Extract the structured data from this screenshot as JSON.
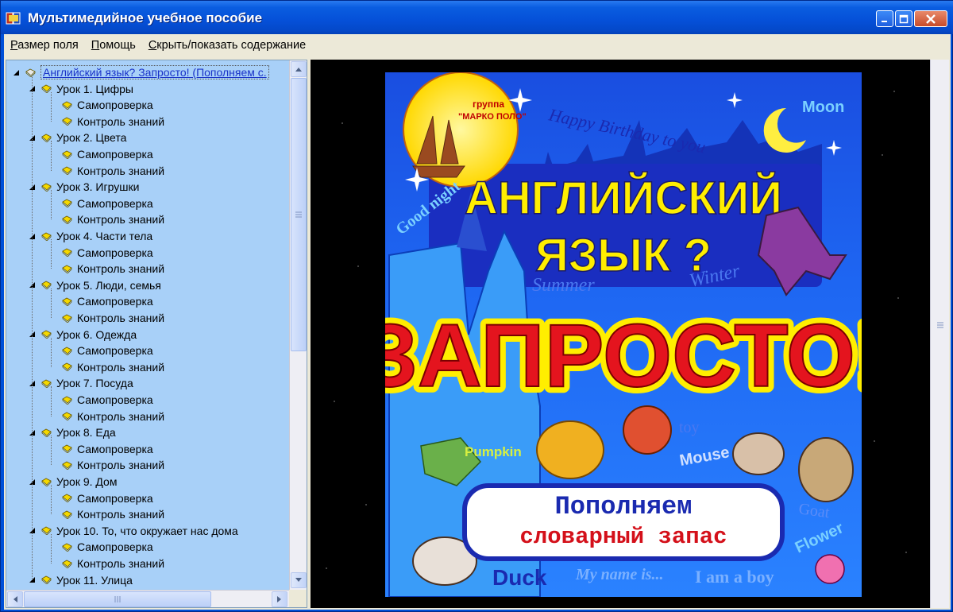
{
  "window": {
    "title": "Мультимедийное учебное пособие"
  },
  "menu": {
    "items": [
      {
        "label": "Размер поля",
        "underline_index": 0
      },
      {
        "label": "Помощь",
        "underline_index": 0
      },
      {
        "label": "Скрыть/показать содержание",
        "underline_index": 0
      }
    ]
  },
  "tree": {
    "root_label": "Английский язык? Запросто! (Пополняем с.",
    "lessons": [
      {
        "label": "Урок 1. Цифры",
        "children": [
          "Самопроверка",
          "Контроль знаний"
        ]
      },
      {
        "label": "Урок 2. Цвета",
        "children": [
          "Самопроверка",
          "Контроль знаний"
        ]
      },
      {
        "label": "Урок 3. Игрушки",
        "children": [
          "Самопроверка",
          "Контроль знаний"
        ]
      },
      {
        "label": "Урок 4. Части тела",
        "children": [
          "Самопроверка",
          "Контроль знаний"
        ]
      },
      {
        "label": "Урок 5. Люди, семья",
        "children": [
          "Самопроверка",
          "Контроль знаний"
        ]
      },
      {
        "label": "Урок 6. Одежда",
        "children": [
          "Самопроверка",
          "Контроль знаний"
        ]
      },
      {
        "label": "Урок 7. Посуда",
        "children": [
          "Самопроверка",
          "Контроль знаний"
        ]
      },
      {
        "label": "Урок 8. Еда",
        "children": [
          "Самопроверка",
          "Контроль знаний"
        ]
      },
      {
        "label": "Урок 9. Дом",
        "children": [
          "Самопроверка",
          "Контроль знаний"
        ]
      },
      {
        "label": "Урок 10. То, что окружает нас дома",
        "children": [
          "Самопроверка",
          "Контроль знаний"
        ]
      },
      {
        "label": "Урок 11. Улица",
        "children": []
      }
    ]
  },
  "cover": {
    "publisher_line1": "группа",
    "publisher_line2": "\"МАРКО ПОЛО\"",
    "title_line1": "АНГЛИЙСКИЙ",
    "title_line2": "ЯЗЫК ?",
    "title_big": "ЗАПРОСТО!",
    "subtitle_line1": "Пополняем",
    "subtitle_line2": "словарный запас",
    "words": {
      "happy_birthday": "Happy Birthday to you",
      "moon": "Moon",
      "good_night": "Good night",
      "summer": "Summer",
      "winter": "Winter",
      "pumpkin": "Pumpkin",
      "toy": "toy",
      "mouse": "Mouse",
      "goat": "Goat",
      "flower": "Flower",
      "duck": "Duck",
      "my_name_is": "My name is...",
      "i_am_a_boy": "I am a boy"
    }
  },
  "colors": {
    "titlebar": "#0550d8",
    "tree_bg": "#a8d0f8",
    "cover_bg": "#1e66f2",
    "title_yellow": "#ffee00",
    "big_red": "#e4141e",
    "subtitle_blue": "#1a2ab0",
    "subtitle_red": "#d4101a"
  }
}
